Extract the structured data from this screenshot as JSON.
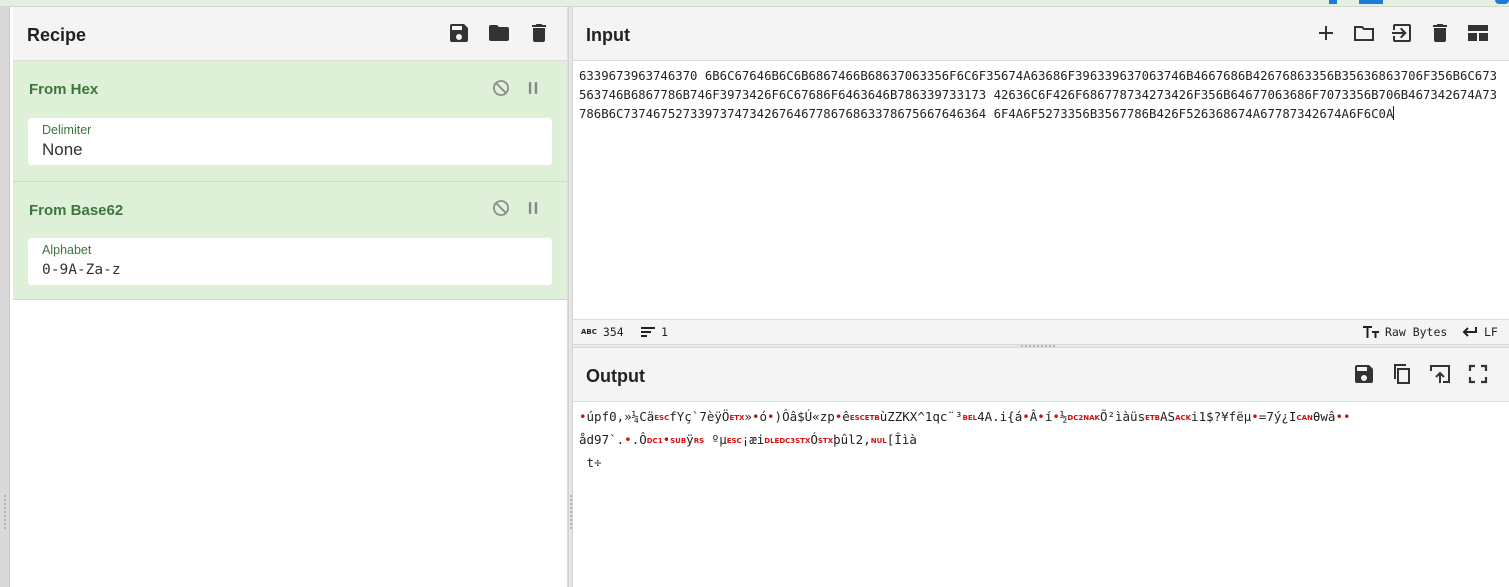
{
  "recipe": {
    "title": "Recipe",
    "operations": [
      {
        "name": "From Hex",
        "arg_label": "Delimiter",
        "arg_value": "None"
      },
      {
        "name": "From Base62",
        "arg_label": "Alphabet",
        "arg_value": "0-9A-Za-z"
      }
    ]
  },
  "input": {
    "title": "Input",
    "text": "6339673963746370 6B6C67646B6C6B6867466B68637063356F6C6F35674A63686F396339637063746B4667686B42676863356B35636863706F356B6C673563746B6867786B746F3973426F6C67686F6463646B786339733173 42636C6F426F686778734273426F356B64677063686F7073356B706B467342674A73786B6C7374675273397374734267646778676863378675667646364 6F4A6F5273356B3567786B426F526368674A67787342674A6F6C0A",
    "stats": {
      "length": "354",
      "lines": "1",
      "encoding": "Raw Bytes",
      "eol": "LF"
    }
  },
  "output": {
    "title": "Output",
    "line1_a": "úpf0,»¼Cä",
    "cc1": "ESC",
    "line1_b": "fYç`7èÿÖ",
    "cc2": "ETX",
    "line1_c": "»",
    "line1_d": "ó",
    "line1_e": ")Ôâ$Ú«zp",
    "line1_f": "ê",
    "cc3": "ESCETB",
    "line1_g": "ùZZKX^1qc¨³",
    "cc4": "BEL",
    "line1_h": "4A.i{á",
    "line1_i": "Â",
    "line1_j": "í",
    "line1_k": "½",
    "cc5": "DC2NAK",
    "line1_l": "Õ²ìàüs",
    "cc6": "ETB",
    "line1_m": "AS",
    "cc7": "ACK",
    "line1_n": "i1$?¥fëµ",
    "line1_o": "=7ý¿I",
    "cc8": "CAN",
    "line1_p": "θwâ",
    "line2_a": "åd97`.",
    "line2_b": ".Ô",
    "cc9": "DC1",
    "cc10": "SUB",
    "line2_c": "ÿ",
    "cc11": "RS",
    "line2_d": " ºµ",
    "cc12": "ESC",
    "line2_e": "¡æi",
    "cc13": "DLEDC3STX",
    "line2_f": "Ó",
    "cc14": "STX",
    "line2_g": "þûl2,",
    "cc15": "NUL",
    "line2_h": "[Îìà",
    "line3": " t÷"
  },
  "icons": {
    "recipe": [
      "save-icon",
      "folder-icon",
      "trash-icon"
    ],
    "op": [
      "disable-icon",
      "pause-icon"
    ],
    "input": [
      "plus-icon",
      "folder-icon",
      "import-icon",
      "trash-icon",
      "layout-icon"
    ],
    "output": [
      "save-icon",
      "copy-icon",
      "export-icon",
      "fullscreen-icon"
    ]
  },
  "colors": {
    "op_bg": "#dff0d8",
    "op_text": "#3c763d",
    "control_char": "#d01010",
    "accent": "#1d7bd8"
  }
}
